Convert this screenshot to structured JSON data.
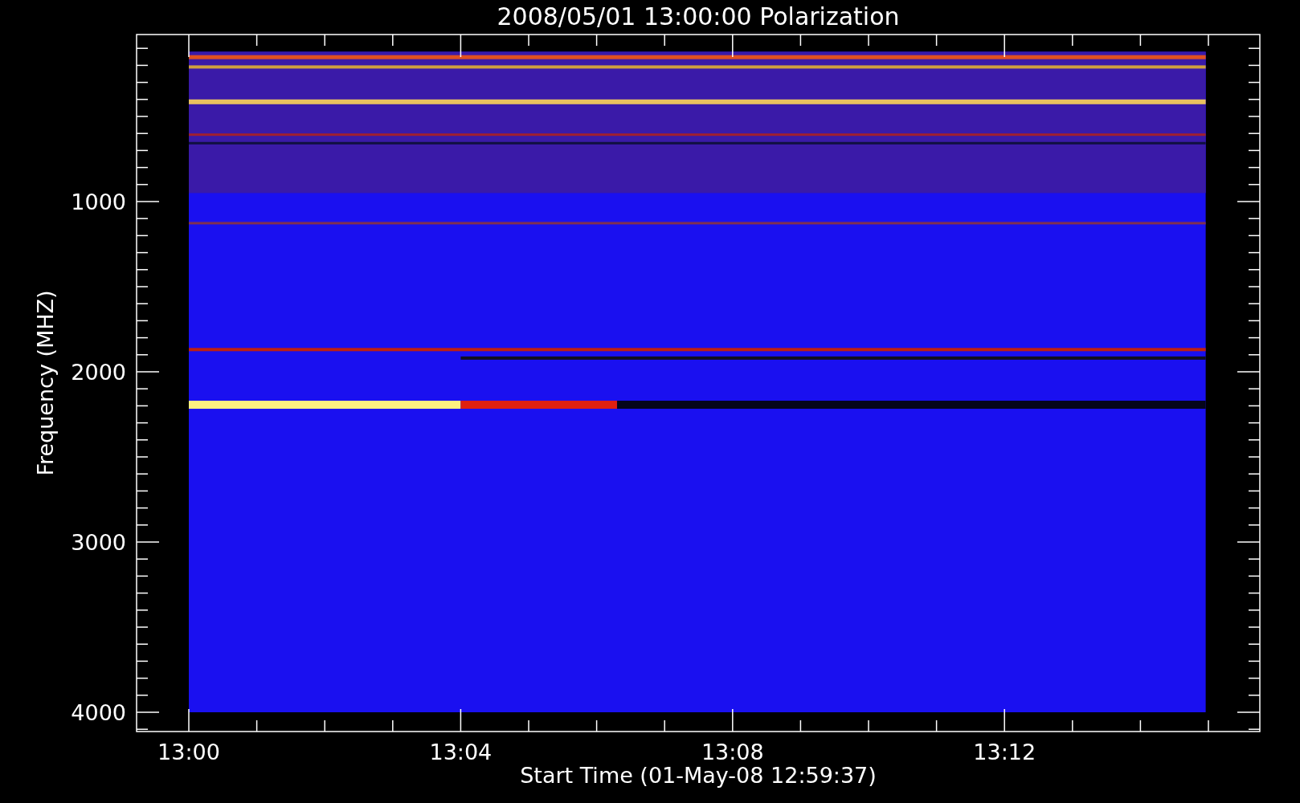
{
  "plot": {
    "title": "2008/05/01 13:00:00 Polarization",
    "y_axis": {
      "title": "Frequency (MHZ)",
      "tick_labels": [
        "1000",
        "2000",
        "3000",
        "4000"
      ]
    },
    "x_axis": {
      "title": "Start Time (01-May-08 12:59:37)",
      "tick_labels": [
        "13:00",
        "13:04",
        "13:08",
        "13:12"
      ]
    }
  }
}
